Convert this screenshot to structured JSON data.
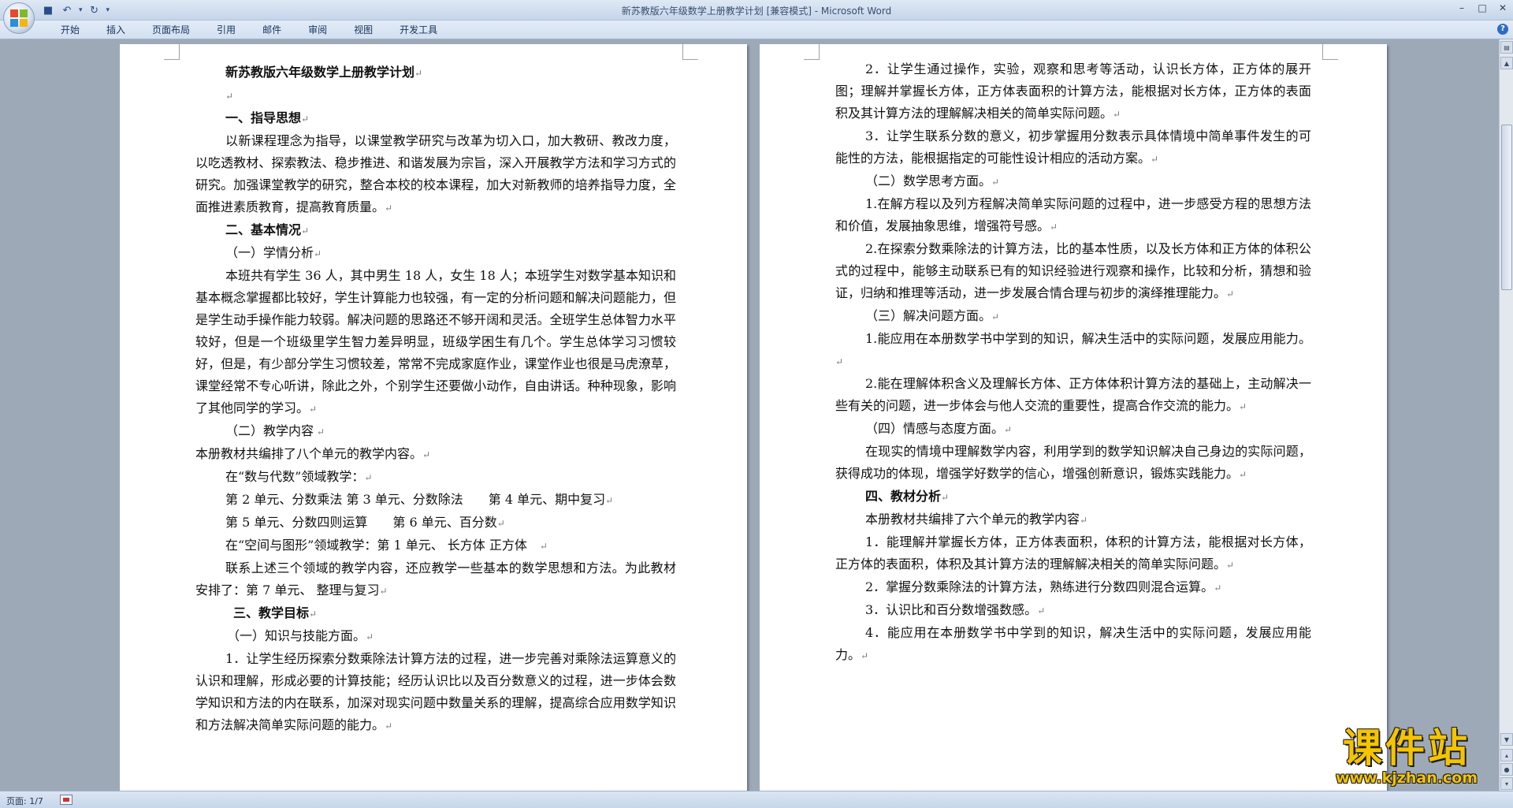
{
  "window": {
    "title": "新苏教版六年级数学上册教学计划 [兼容模式] - Microsoft Word",
    "controls": {
      "minimize": "–",
      "maximize": "□",
      "close": "✕"
    }
  },
  "quick_access": {
    "save_icon": "save-icon",
    "undo_icon": "undo-icon",
    "redo_icon": "redo-icon"
  },
  "tabs": [
    "开始",
    "插入",
    "页面布局",
    "引用",
    "邮件",
    "审阅",
    "视图",
    "开发工具"
  ],
  "status": {
    "page": "页面: 1/7"
  },
  "watermark": {
    "title": "课件站",
    "url": "www.kjzhan.com"
  },
  "pages": {
    "left": {
      "title": "新苏教版六年级数学上册教学计划",
      "s1_heading": "一、指导思想",
      "s1_p1": "以新课程理念为指导，以课堂教学研究与改革为切入口，加大教研、教改力度，以吃透教材、探索教法、稳步推进、和谐发展为宗旨，深入开展教学方法和学习方式的研究。加强课堂教学的研究，整合本校的校本课程，加大对新教师的培养指导力度，全面推进素质教育，提高教育质量。",
      "s2_heading": "二、基本情况",
      "s2_sub1": "（一）学情分析",
      "s2_p1": "本班共有学生 36 人，其中男生 18 人，女生 18 人；本班学生对数学基本知识和基本概念掌握都比较好，学生计算能力也较强，有一定的分析问题和解决问题能力，但是学生动手操作能力较弱。解决问题的思路还不够开阔和灵活。全班学生总体智力水平较好，但是一个班级里学生智力差异明显，班级学困生有几个。学生总体学习习惯较好，但是，有少部分学生习惯较差，常常不完成家庭作业，课堂作业也很是马虎潦草，课堂经常不专心听讲，除此之外，个别学生还要做小动作，自由讲话。种种现象，影响了其他同学的学习。",
      "s2_sub2": "（二）教学内容",
      "s2_p2": "本册教材共编排了八个单元的教学内容。",
      "s2_p3": "在“数与代数”领域教学：",
      "s2_p4": "第 2 单元、分数乘法 第 3 单元、分数除法　　第 4 单元、期中复习",
      "s2_p5": "第 5 单元、分数四则运算　　第 6 单元、百分数",
      "s2_p6": "在“空间与图形”领域教学：第 1 单元、 长方体 正方体　",
      "s2_p7": "联系上述三个领域的教学内容，还应教学一些基本的数学思想和方法。为此教材安排了：第 7 单元、 整理与复习",
      "s3_heading": "三、教学目标",
      "s3_sub1": "（一）知识与技能方面。",
      "s3_p1": "1．让学生经历探索分数乘除法计算方法的过程，进一步完善对乘除法运算意义的认识和理解，形成必要的计算技能；经历认识比以及百分数意义的过程，进一步体会数学知识和方法的内在联系，加深对现实问题中数量关系的理解，提高综合应用数学知识和方法解决简单实际问题的能力。"
    },
    "right": {
      "p1": "2．让学生通过操作，实验，观察和思考等活动，认识长方体，正方体的展开图；理解并掌握长方体，正方体表面积的计算方法，能根据对长方体，正方体的表面积及其计算方法的理解解决相关的简单实际问题。",
      "p2": "3．让学生联系分数的意义，初步掌握用分数表示具体情境中简单事件发生的可能性的方法，能根据指定的可能性设计相应的活动方案。",
      "sub2": "（二）数学思考方面。",
      "p3": "1.在解方程以及列方程解决简单实际问题的过程中，进一步感受方程的思想方法和价值，发展抽象思维，增强符号感。",
      "p4": "2.在探索分数乘除法的计算方法，比的基本性质，以及长方体和正方体的体积公式的过程中，能够主动联系已有的知识经验进行观察和操作，比较和分析，猜想和验证，归纳和推理等活动，进一步发展合情合理与初步的演绎推理能力。",
      "sub3": "（三）解决问题方面。",
      "p5": "1.能应用在本册数学书中学到的知识，解决生活中的实际问题，发展应用能力。",
      "p6": "2.能在理解体积含义及理解长方体、正方体体积计算方法的基础上，主动解决一些有关的问题，进一步体会与他人交流的重要性，提高合作交流的能力。",
      "sub4": "（四）情感与态度方面。",
      "p7": "在现实的情境中理解数学内容，利用学到的数学知识解决自己身边的实际问题，获得成功的体现，增强学好数学的信心，增强创新意识，锻炼实践能力。",
      "s4_heading": "四、教材分析",
      "p8": "本册教材共编排了六个单元的教学内容",
      "p9": "1．能理解并掌握长方体，正方体表面积，体积的计算方法，能根据对长方体，正方体的表面积，体积及其计算方法的理解解决相关的简单实际问题。",
      "p10": "2．掌握分数乘除法的计算方法，熟练进行分数四则混合运算。",
      "p11": "3．认识比和百分数增强数感。",
      "p12": "4．能应用在本册数学书中学到的知识，解决生活中的实际问题，发展应用能力。"
    }
  }
}
